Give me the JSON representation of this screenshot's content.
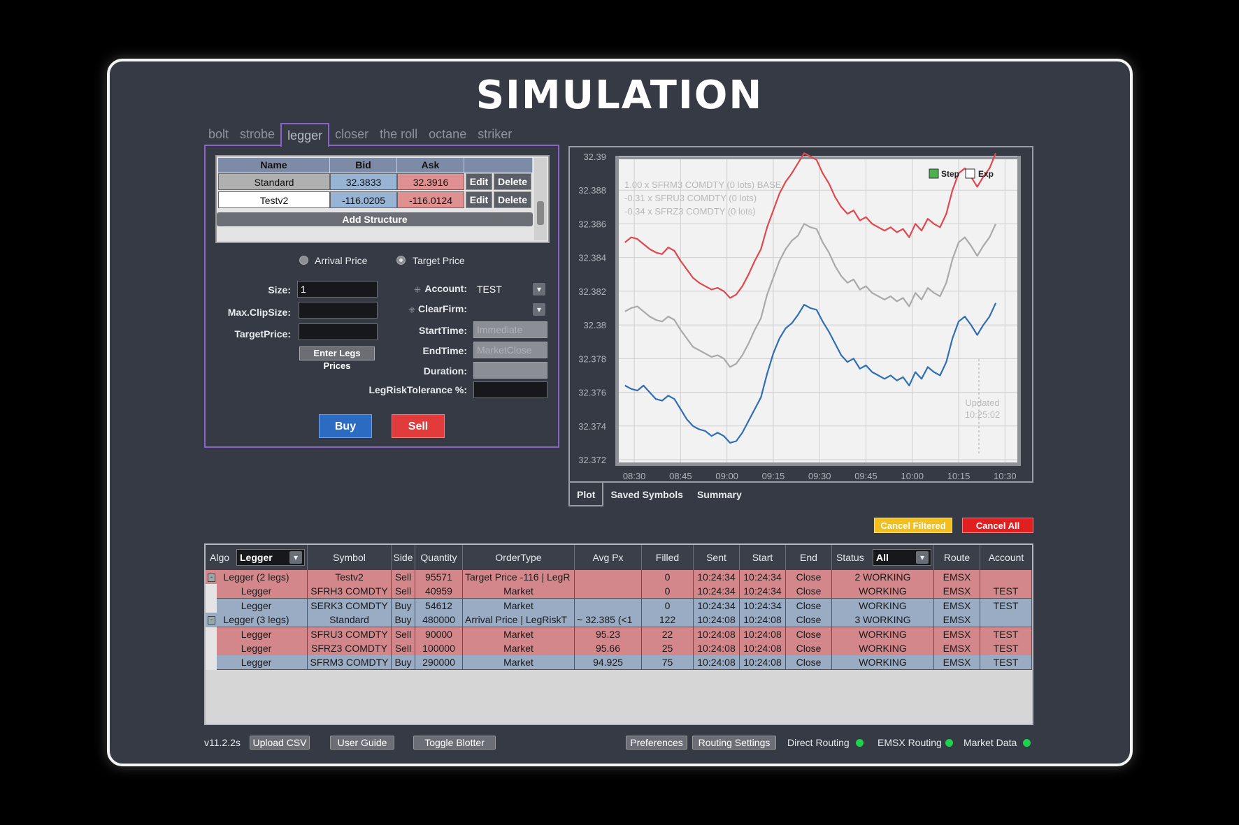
{
  "title": "SIMULATION",
  "tabs": [
    "bolt",
    "strobe",
    "legger",
    "closer",
    "the roll",
    "octane",
    "striker"
  ],
  "active_tab": "legger",
  "structures": {
    "headers": [
      "Name",
      "Bid",
      "Ask"
    ],
    "rows": [
      {
        "name": "Standard",
        "bid": "32.3833",
        "ask": "32.3916",
        "edit": "Edit",
        "delete": "Delete"
      },
      {
        "name": "Testv2",
        "bid": "-116.0205",
        "ask": "-116.0124",
        "edit": "Edit",
        "delete": "Delete"
      }
    ],
    "add_label": "Add Structure"
  },
  "price_mode": {
    "arrival": "Arrival Price",
    "target": "Target Price",
    "selected": "Target Price"
  },
  "form": {
    "size_label": "Size:",
    "size_value": "1",
    "max_clip_label": "Max.ClipSize:",
    "max_clip_value": "",
    "target_price_label": "TargetPrice:",
    "target_price_value": "",
    "enter_legs_label": "Enter Legs Prices",
    "account_label": "Account:",
    "account_value": "TEST",
    "clearfirm_label": "ClearFirm:",
    "clearfirm_value": "",
    "start_label": "StartTime:",
    "start_placeholder": "Immediate",
    "end_label": "EndTime:",
    "end_placeholder": "MarketClose",
    "duration_label": "Duration:",
    "duration_value": "",
    "legrisk_label": "LegRiskTolerance %:",
    "legrisk_value": ""
  },
  "actions": {
    "buy": "Buy",
    "sell": "Sell"
  },
  "chart_tabs": [
    "Plot",
    "Saved Symbols",
    "Summary"
  ],
  "chart_data": {
    "type": "line",
    "x": [
      "08:27",
      "08:29",
      "08:31",
      "08:33",
      "08:35",
      "08:37",
      "08:39",
      "08:41",
      "08:43",
      "08:45",
      "08:47",
      "08:49",
      "08:51",
      "08:53",
      "08:55",
      "08:57",
      "08:59",
      "09:01",
      "09:03",
      "09:05",
      "09:07",
      "09:09",
      "09:11",
      "09:13",
      "09:15",
      "09:17",
      "09:19",
      "09:21",
      "09:23",
      "09:25",
      "09:27",
      "09:29",
      "09:31",
      "09:33",
      "09:35",
      "09:37",
      "09:39",
      "09:41",
      "09:43",
      "09:45",
      "09:47",
      "09:49",
      "09:51",
      "09:53",
      "09:55",
      "09:57",
      "09:59",
      "10:01",
      "10:03",
      "10:05",
      "10:07",
      "10:09",
      "10:11",
      "10:13",
      "10:15",
      "10:17",
      "10:19",
      "10:21",
      "10:23",
      "10:25",
      "10:27"
    ],
    "series": [
      {
        "color": "#e0484f",
        "values": [
          32.3849,
          32.3852,
          32.3851,
          32.3848,
          32.3845,
          32.3843,
          32.3842,
          32.3846,
          32.3844,
          32.3838,
          32.3833,
          32.3828,
          32.3825,
          32.3823,
          32.3821,
          32.3822,
          32.382,
          32.3816,
          32.3818,
          32.3823,
          32.383,
          32.3838,
          32.3845,
          32.3858,
          32.3868,
          32.3878,
          32.3885,
          32.389,
          32.3896,
          32.3902,
          32.39,
          32.3898,
          32.389,
          32.3884,
          32.3876,
          32.387,
          32.3866,
          32.3868,
          32.3862,
          32.3864,
          32.386,
          32.3858,
          32.3856,
          32.3858,
          32.3855,
          32.3857,
          32.3852,
          32.386,
          32.3856,
          32.3863,
          32.386,
          32.3858,
          32.3866,
          32.388,
          32.389,
          32.3893,
          32.3888,
          32.3882,
          32.3888,
          32.3893,
          32.3902
        ]
      },
      {
        "color": "#a9a9a9",
        "values": [
          32.3808,
          32.381,
          32.3811,
          32.3808,
          32.3805,
          32.3803,
          32.3802,
          32.3805,
          32.3803,
          32.3797,
          32.3792,
          32.3787,
          32.3785,
          32.3783,
          32.3781,
          32.3782,
          32.378,
          32.3775,
          32.3777,
          32.3782,
          32.3789,
          32.3797,
          32.3804,
          32.3818,
          32.3828,
          32.3838,
          32.3845,
          32.385,
          32.3853,
          32.386,
          32.3858,
          32.3857,
          32.3849,
          32.3843,
          32.3835,
          32.3829,
          32.3825,
          32.3827,
          32.3821,
          32.3823,
          32.3819,
          32.3817,
          32.3815,
          32.3817,
          32.3814,
          32.3816,
          32.3811,
          32.3819,
          32.3815,
          32.3822,
          32.3819,
          32.3817,
          32.3825,
          32.3839,
          32.3849,
          32.3852,
          32.3847,
          32.3841,
          32.3847,
          32.3852,
          32.386
        ]
      },
      {
        "color": "#2f6eb5",
        "values": [
          32.3764,
          32.3762,
          32.3761,
          32.3764,
          32.376,
          32.3756,
          32.3755,
          32.3758,
          32.3756,
          32.375,
          32.3744,
          32.374,
          32.3738,
          32.3737,
          32.3734,
          32.3736,
          32.3734,
          32.373,
          32.3731,
          32.3736,
          32.3743,
          32.375,
          32.3757,
          32.3771,
          32.3783,
          32.3792,
          32.3798,
          32.3801,
          32.3806,
          32.3812,
          32.381,
          32.3809,
          32.3802,
          32.3796,
          32.3789,
          32.3782,
          32.3778,
          32.378,
          32.3774,
          32.3776,
          32.3772,
          32.377,
          32.3768,
          32.377,
          32.3767,
          32.3769,
          32.3764,
          32.3772,
          32.3768,
          32.3775,
          32.3772,
          32.377,
          32.3778,
          32.3792,
          32.3802,
          32.3805,
          32.38,
          32.3794,
          32.38,
          32.3805,
          32.3813
        ]
      }
    ],
    "yticks": [
      "32.39",
      "32.388",
      "32.386",
      "32.384",
      "32.382",
      "32.38",
      "32.378",
      "32.376",
      "32.374",
      "32.372"
    ],
    "xticks": [
      "08:30",
      "08:45",
      "09:00",
      "09:15",
      "09:30",
      "09:45",
      "10:00",
      "10:15",
      "10:30"
    ],
    "ylim": [
      32.372,
      32.39
    ],
    "legend_text": [
      "1.00 x SFRM3 COMDTY (0 lots) BASE",
      "-0.31 x SFRU3 COMDTY (0 lots)",
      "-0.34 x SFRZ3 COMDTY (0 lots)"
    ],
    "toggles": [
      {
        "label": "Step",
        "checked": true
      },
      {
        "label": "Exp",
        "checked": false
      }
    ],
    "updated_label": "Updated",
    "updated_time": "10:25:02",
    "grid": true
  },
  "blotter": {
    "cancel_filtered": "Cancel Filtered",
    "cancel_all": "Cancel All",
    "algo_label": "Algo",
    "algo_filter": "Legger",
    "status_label": "Status",
    "status_filter": "All",
    "headers": [
      "Symbol",
      "Side",
      "Quantity",
      "OrderType",
      "Avg Px",
      "Filled",
      "Sent",
      "Start",
      "End",
      "Route",
      "Account"
    ],
    "rows": [
      {
        "kind": "parent",
        "color": "#d4878a",
        "algo": "Legger (2 legs)",
        "symbol": "Testv2",
        "side": "Sell",
        "quantity": "95571",
        "ordertype": "Target Price -116 | LegR",
        "avgpx": "",
        "filled": "0",
        "sent": "10:24:34",
        "start": "10:24:34",
        "end": "Close",
        "status": "2 WORKING",
        "route": "EMSX",
        "account": ""
      },
      {
        "kind": "child",
        "color": "#d4878a",
        "algo": "Legger",
        "symbol": "SFRH3 COMDTY",
        "side": "Sell",
        "quantity": "40959",
        "ordertype": "Market",
        "avgpx": "",
        "filled": "0",
        "sent": "10:24:34",
        "start": "10:24:34",
        "end": "Close",
        "status": "WORKING",
        "route": "EMSX",
        "account": "TEST"
      },
      {
        "kind": "child",
        "color": "#9aabc4",
        "algo": "Legger",
        "symbol": "SERK3 COMDTY",
        "side": "Buy",
        "quantity": "54612",
        "ordertype": "Market",
        "avgpx": "",
        "filled": "0",
        "sent": "10:24:34",
        "start": "10:24:34",
        "end": "Close",
        "status": "WORKING",
        "route": "EMSX",
        "account": "TEST"
      },
      {
        "kind": "parent",
        "color": "#9aabc4",
        "algo": "Legger (3 legs)",
        "symbol": "Standard",
        "side": "Buy",
        "quantity": "480000",
        "ordertype": "Arrival Price | LegRiskT",
        "avgpx": "~ 32.385 (<1",
        "filled": "122",
        "sent": "10:24:08",
        "start": "10:24:08",
        "end": "Close",
        "status": "3 WORKING",
        "route": "EMSX",
        "account": ""
      },
      {
        "kind": "child",
        "color": "#d4878a",
        "algo": "Legger",
        "symbol": "SFRU3 COMDTY",
        "side": "Sell",
        "quantity": "90000",
        "ordertype": "Market",
        "avgpx": "95.23",
        "filled": "22",
        "sent": "10:24:08",
        "start": "10:24:08",
        "end": "Close",
        "status": "WORKING",
        "route": "EMSX",
        "account": "TEST"
      },
      {
        "kind": "child",
        "color": "#d4878a",
        "algo": "Legger",
        "symbol": "SFRZ3 COMDTY",
        "side": "Sell",
        "quantity": "100000",
        "ordertype": "Market",
        "avgpx": "95.66",
        "filled": "25",
        "sent": "10:24:08",
        "start": "10:24:08",
        "end": "Close",
        "status": "WORKING",
        "route": "EMSX",
        "account": "TEST"
      },
      {
        "kind": "child",
        "color": "#9aabc4",
        "algo": "Legger",
        "symbol": "SFRM3 COMDTY",
        "side": "Buy",
        "quantity": "290000",
        "ordertype": "Market",
        "avgpx": "94.925",
        "filled": "75",
        "sent": "10:24:08",
        "start": "10:24:08",
        "end": "Close",
        "status": "WORKING",
        "route": "EMSX",
        "account": "TEST"
      }
    ]
  },
  "footer": {
    "version": "v11.2.2s",
    "upload_csv": "Upload CSV",
    "user_guide": "User Guide",
    "toggle_blotter": "Toggle Blotter",
    "preferences": "Preferences",
    "routing_settings": "Routing Settings",
    "direct_routing": "Direct Routing",
    "emsx_routing": "EMSX Routing",
    "market_data": "Market Data"
  }
}
